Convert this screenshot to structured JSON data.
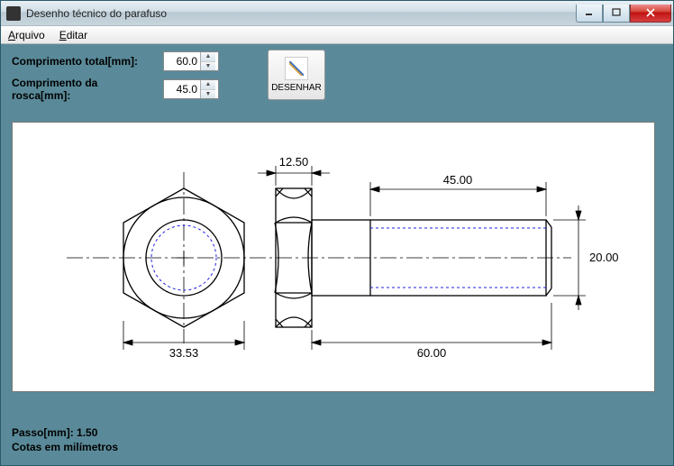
{
  "window": {
    "title": "Desenho técnico do parafuso"
  },
  "menu": {
    "arquivo": "Arquivo",
    "editar": "Editar"
  },
  "form": {
    "comprimento_total_label": "Comprimento total[mm]:",
    "comprimento_total_value": "60.0",
    "comprimento_rosca_label": "Comprimento da rosca[mm]:",
    "comprimento_rosca_value": "45.0",
    "desenhar_label": "DESENHAR"
  },
  "drawing": {
    "dims": {
      "head_width": "12.50",
      "thread_length": "45.00",
      "shaft_height": "20.00",
      "total_length": "60.00",
      "across_corners": "33.53"
    }
  },
  "footer": {
    "passo": "Passo[mm]: 1.50",
    "cotas": "Cotas em milímetros"
  }
}
